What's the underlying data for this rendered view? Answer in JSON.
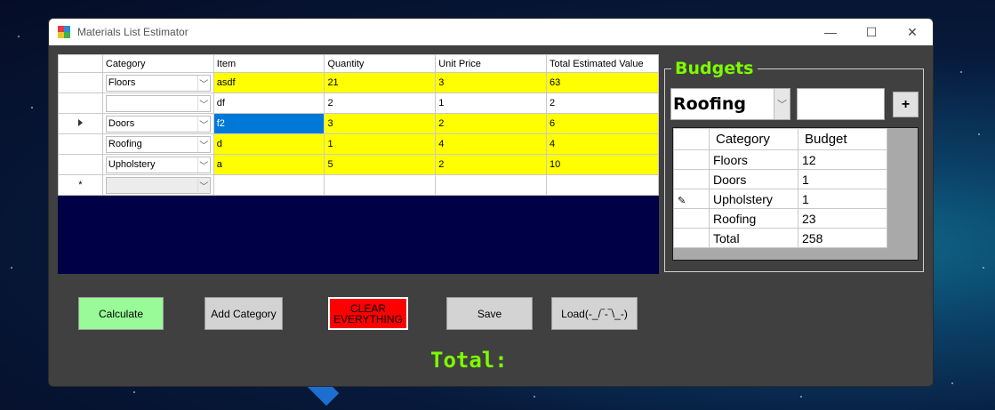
{
  "window": {
    "title": "Materials List Estimator",
    "controls": {
      "minimize": "—",
      "maximize": "☐",
      "close": "✕"
    }
  },
  "grid": {
    "columns": [
      "Category",
      "Item",
      "Quantity",
      "Unit Price",
      "Total Estimated Value"
    ],
    "rows": [
      {
        "category": "Floors",
        "item": "asdf",
        "quantity": "21",
        "unit_price": "3",
        "total": "63",
        "highlight": true
      },
      {
        "category": "",
        "item": "df",
        "quantity": "2",
        "unit_price": "1",
        "total": "2",
        "highlight": false
      },
      {
        "category": "Doors",
        "item": "f2",
        "quantity": "3",
        "unit_price": "2",
        "total": "6",
        "highlight": true,
        "current": true
      },
      {
        "category": "Roofing",
        "item": "d",
        "quantity": "1",
        "unit_price": "4",
        "total": "4",
        "highlight": true
      },
      {
        "category": "Upholstery",
        "item": "a",
        "quantity": "5",
        "unit_price": "2",
        "total": "10",
        "highlight": true
      }
    ],
    "new_row_marker": "*"
  },
  "budgets": {
    "title": "Budgets",
    "selected_category": "Roofing",
    "amount_value": "",
    "add_button": "+",
    "columns": [
      "Category",
      "Budget"
    ],
    "rows": [
      {
        "category": "Floors",
        "budget": "12"
      },
      {
        "category": "Doors",
        "budget": "1"
      },
      {
        "category": "Upholstery",
        "budget": "1",
        "editing": true
      },
      {
        "category": "Roofing",
        "budget": "23"
      },
      {
        "category": "Total",
        "budget": "258"
      }
    ]
  },
  "buttons": {
    "calculate": "Calculate",
    "add_category": "Add Category",
    "clear_line1": "CLEAR",
    "clear_line2": "EVERYTHING",
    "save": "Save",
    "load": "Load(-_/‾-‾\\_-)"
  },
  "total_label": "Total:",
  "colors": {
    "highlight_row": "#ffff00",
    "selected_cell": "#0078d7",
    "accent_text": "#7cfc00",
    "calculate_button": "#98fb98",
    "clear_button": "#ff0000"
  }
}
